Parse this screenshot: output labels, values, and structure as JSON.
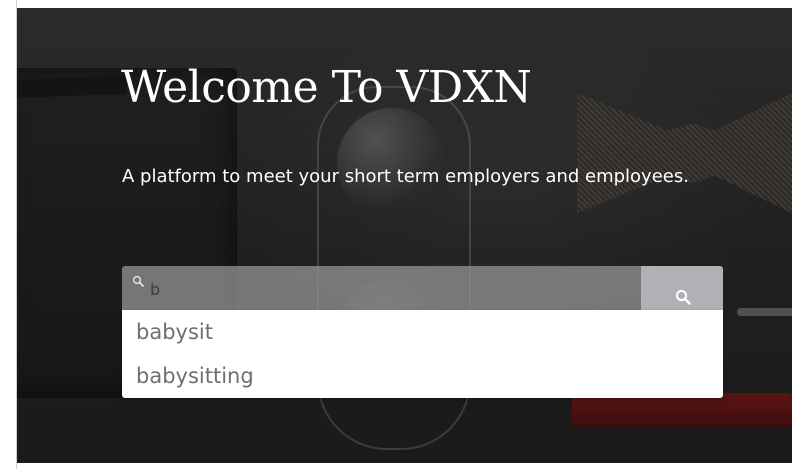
{
  "hero": {
    "title": "Welcome To VDXN",
    "subtitle": "A platform to meet your short term employers and employees."
  },
  "search": {
    "value": "b",
    "input_icon": "search-icon",
    "button_icon": "search-icon"
  },
  "suggestions": [
    {
      "label": "babysit"
    },
    {
      "label": "babysitting"
    }
  ],
  "colors": {
    "hero_bg": "#2e2e2e",
    "text": "#ffffff",
    "suggestion_text": "#6f6f6f",
    "input_bg": "#969696",
    "button_bg": "#bcbec2"
  }
}
